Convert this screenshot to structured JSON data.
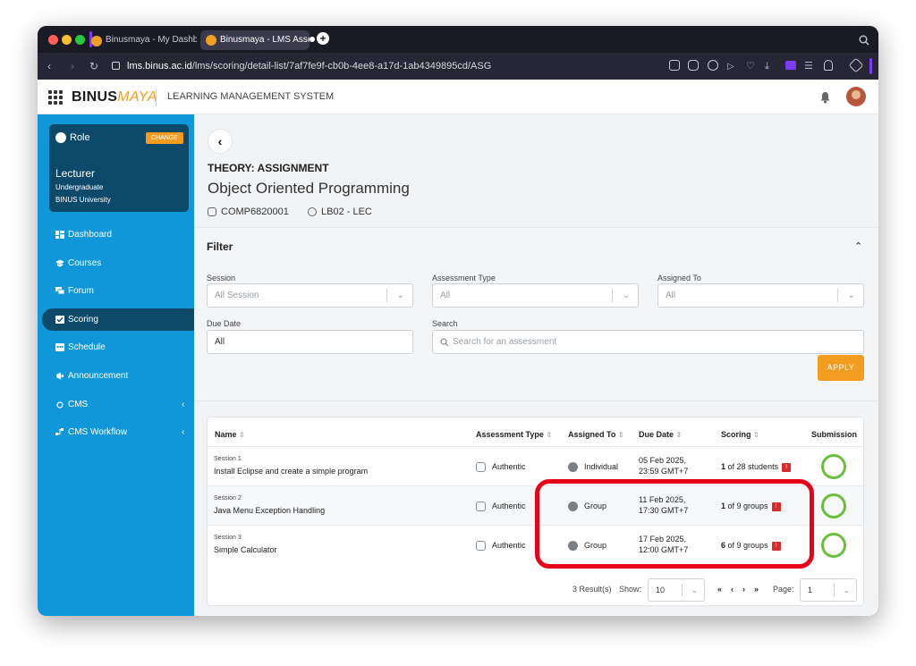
{
  "browser": {
    "tabs": [
      {
        "title": "Binusmaya - My Dashbo"
      },
      {
        "title": "Binusmaya - LMS Asses"
      }
    ],
    "url_domain": "lms.binus.ac.id",
    "url_path": "/lms/scoring/detail-list/7af7fe9f-cb0b-4ee8-a17d-1ab4349895cd/ASG",
    "colors": {
      "accent": "#7a3cff"
    }
  },
  "header": {
    "logo_main": "BINUS",
    "logo_accent": "MAYA",
    "system_title": "LEARNING MANAGEMENT SYSTEM"
  },
  "role_card": {
    "label": "Role",
    "change_label": "CHANGE",
    "role": "Lecturer",
    "level": "Undergraduate",
    "university": "BINUS University"
  },
  "sidebar": {
    "items": [
      {
        "label": "Dashboard",
        "icon": "grid-icon"
      },
      {
        "label": "Courses",
        "icon": "graduation-cap-icon"
      },
      {
        "label": "Forum",
        "icon": "chat-icon"
      },
      {
        "label": "Scoring",
        "icon": "check-square-icon",
        "active": true
      },
      {
        "label": "Schedule",
        "icon": "calendar-icon"
      },
      {
        "label": "Announcement",
        "icon": "megaphone-icon"
      },
      {
        "label": "CMS",
        "icon": "cms-icon"
      },
      {
        "label": "CMS Workflow",
        "icon": "workflow-icon"
      }
    ],
    "colors": {
      "bg": "#0f97d9",
      "active": "#0d4a6a"
    }
  },
  "page": {
    "category": "THEORY: ASSIGNMENT",
    "course_name": "Object Oriented Programming",
    "course_code": "COMP6820001",
    "class_code": "LB02 - LEC"
  },
  "filter": {
    "title": "Filter",
    "session_label": "Session",
    "session_value": "All Session",
    "type_label": "Assessment Type",
    "type_value": "All",
    "assigned_label": "Assigned To",
    "assigned_value": "All",
    "due_label": "Due Date",
    "due_value": "All",
    "search_label": "Search",
    "search_placeholder": "Search for an assessment",
    "apply_label": "APPLY",
    "colors": {
      "apply": "#f39c1f"
    }
  },
  "table": {
    "headers": {
      "name": "Name",
      "type": "Assessment Type",
      "assigned": "Assigned To",
      "due": "Due Date",
      "scoring": "Scoring",
      "submission": "Submission"
    },
    "rows": [
      {
        "session": "Session 1",
        "name": "Install Eclipse and create a simple program",
        "type": "Authentic",
        "assigned": "Individual",
        "due_date": "05 Feb 2025,",
        "due_time": "23:59 GMT+7",
        "score_num": "1",
        "score_rest": "of 28 students"
      },
      {
        "session": "Session 2",
        "name": "Java Menu Exception Handling",
        "type": "Authentic",
        "assigned": "Group",
        "due_date": "11 Feb 2025,",
        "due_time": "17:30 GMT+7",
        "score_num": "1",
        "score_rest": "of 9 groups"
      },
      {
        "session": "Session 3",
        "name": "Simple Calculator",
        "type": "Authentic",
        "assigned": "Group",
        "due_date": "17 Feb 2025,",
        "due_time": "12:00 GMT+7",
        "score_num": "6",
        "score_rest": "of 9 groups"
      }
    ],
    "info_badge": "!",
    "colors": {
      "submission_ring": "#6bbf3a",
      "badge": "#d92b2b",
      "highlight": "#e8001a"
    }
  },
  "pager": {
    "results": "3 Result(s)",
    "show_label": "Show:",
    "show_value": "10",
    "first": "«",
    "prev": "‹",
    "next": "›",
    "last": "»",
    "page_label": "Page:",
    "page_value": "1"
  }
}
